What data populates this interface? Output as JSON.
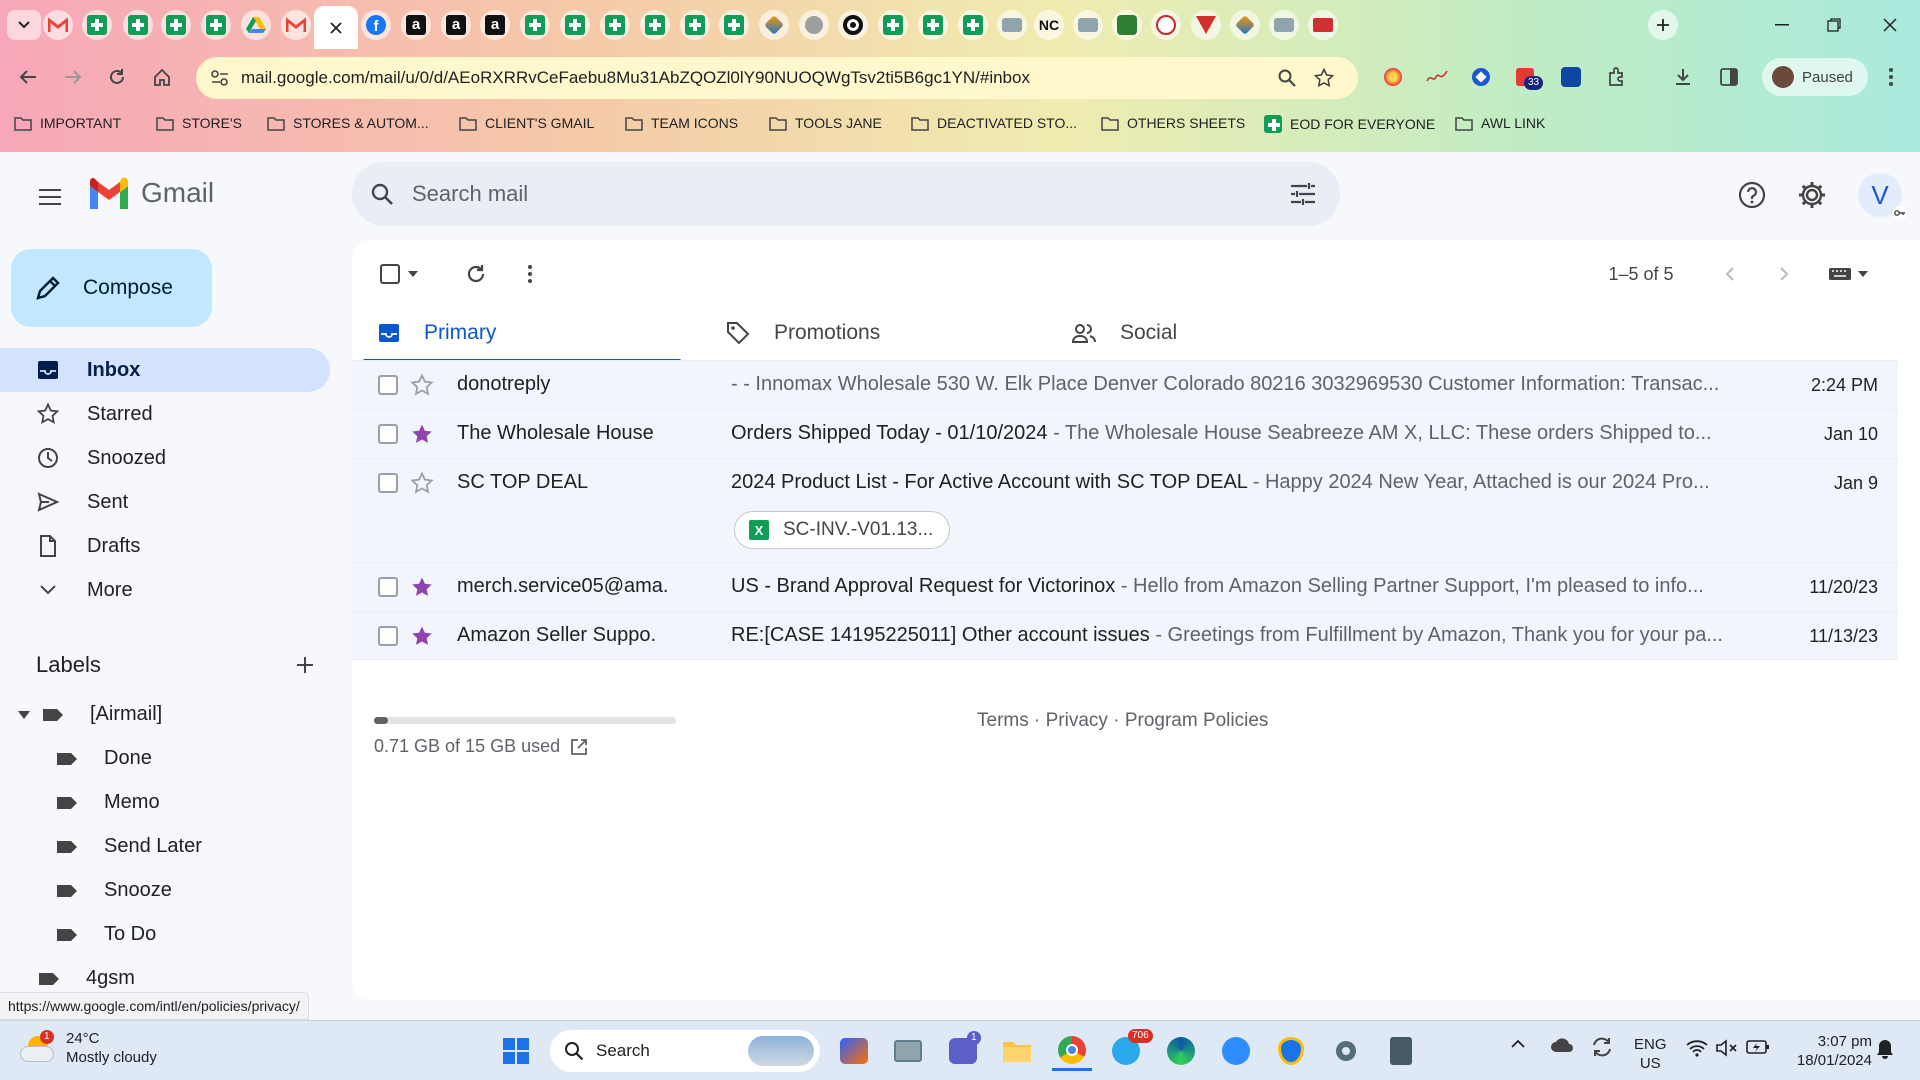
{
  "browser": {
    "url": "mail.google.com/mail/u/0/d/AEoRXRRvCeFaebu8Mu31AbZQOZl0lY90NUOQWgTsv2ti5B6gc1YN/#inbox",
    "profile_status": "Paused",
    "extension_badge": "33",
    "bookmarks": [
      "IMPORTANT",
      "STORE'S",
      "STORES & AUTOM...",
      "CLIENT'S GMAIL",
      "TEAM ICONS",
      "TOOLS JANE",
      "DEACTIVATED STO...",
      "OTHERS SHEETS",
      "EOD FOR EVERYONE",
      "AWL LINK"
    ],
    "tab_letters": {
      "nc": "NC",
      "amazon": "a"
    }
  },
  "gmail": {
    "app_name": "Gmail",
    "search_placeholder": "Search mail",
    "compose_label": "Compose",
    "avatar_initial": "V",
    "nav": [
      {
        "label": "Inbox",
        "icon": "inbox-icon"
      },
      {
        "label": "Starred",
        "icon": "star-icon"
      },
      {
        "label": "Snoozed",
        "icon": "clock-icon"
      },
      {
        "label": "Sent",
        "icon": "send-icon"
      },
      {
        "label": "Drafts",
        "icon": "draft-icon"
      },
      {
        "label": "More",
        "icon": "chevron-down-icon"
      }
    ],
    "labels_heading": "Labels",
    "labels": [
      {
        "name": "[Airmail]",
        "level": 0,
        "expanded": true
      },
      {
        "name": "Done",
        "level": 1
      },
      {
        "name": "Memo",
        "level": 1
      },
      {
        "name": "Send Later",
        "level": 1
      },
      {
        "name": "Snooze",
        "level": 1
      },
      {
        "name": "To Do",
        "level": 1
      },
      {
        "name": "4gsm",
        "level": 0
      }
    ],
    "pagination": "1–5 of 5",
    "tabs": [
      {
        "label": "Primary",
        "icon": "inbox-icon"
      },
      {
        "label": "Promotions",
        "icon": "tag-icon"
      },
      {
        "label": "Social",
        "icon": "people-icon"
      }
    ],
    "emails": [
      {
        "sender": "donotreply",
        "starred": false,
        "subject": "",
        "snippet": "- - Innomax Wholesale 530 W. Elk Place Denver Colorado 80216 3032969530 Customer Information: Transac...",
        "date": "2:24 PM"
      },
      {
        "sender": "The Wholesale House",
        "starred": true,
        "subject": "Orders Shipped Today - 01/10/2024",
        "snippet": " - The Wholesale House Seabreeze AM X, LLC: These orders Shipped to...",
        "date": "Jan 10"
      },
      {
        "sender": "SC TOP DEAL",
        "starred": false,
        "subject": "2024 Product List - For Active Account with SC TOP DEAL",
        "snippet": " - Happy 2024 New Year, Attached is our 2024 Pro...",
        "date": "Jan 9",
        "attachment": "SC-INV.-V01.13..."
      },
      {
        "sender": "merch.service05@ama.",
        "starred": true,
        "subject": "US - Brand Approval Request for Victorinox",
        "snippet": " - Hello from Amazon Selling Partner Support, I'm pleased to info...",
        "date": "11/20/23"
      },
      {
        "sender": "Amazon Seller Suppo.",
        "starred": true,
        "subject": "RE:[CASE 14195225011] Other account issues",
        "snippet": " - Greetings from Fulfillment by Amazon, Thank you for your pa...",
        "date": "11/13/23"
      }
    ],
    "storage_text": "0.71 GB of 15 GB used",
    "storage_fraction": 0.047,
    "footer_links": [
      "Terms",
      "Privacy",
      "Program Policies"
    ],
    "status_url": "https://www.google.com/intl/en/policies/privacy/"
  },
  "taskbar": {
    "weather_temp": "24°C",
    "weather_desc": "Mostly cloudy",
    "weather_badge": "1",
    "search_label": "Search",
    "telegram_badge": "706",
    "teams_badge": "1",
    "lang_top": "ENG",
    "lang_bottom": "US",
    "time": "3:07 pm",
    "date": "18/01/2024"
  },
  "colors": {
    "accent": "#0b57d0",
    "compose": "#c2e7ff",
    "selected_nav": "#d3e3fd",
    "star": "#8e44ad",
    "sheets": "#0f9d58"
  }
}
